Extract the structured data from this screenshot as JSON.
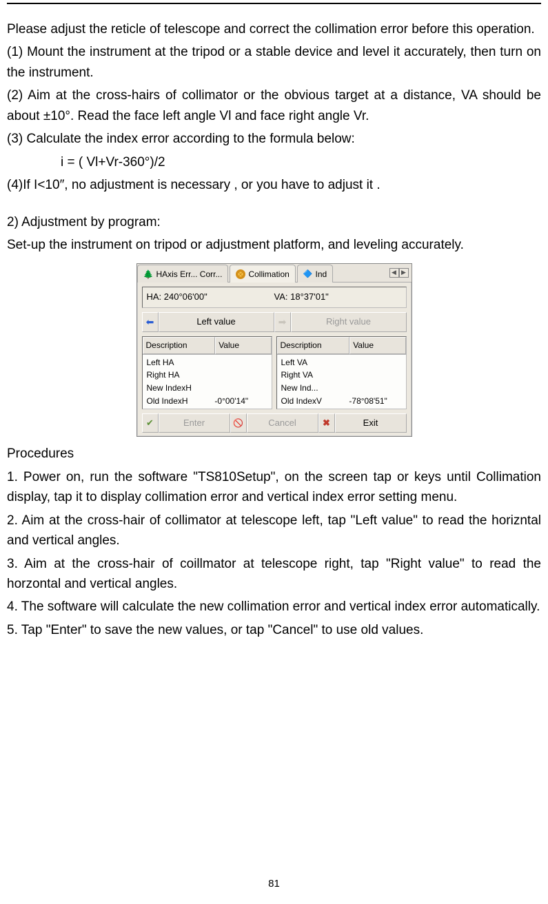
{
  "page_number": "81",
  "doc": {
    "intro": "Please adjust the reticle of telescope and correct the collimation error before this operation.",
    "step1": "(1) Mount the instrument at the tripod or a stable device and level it accurately, then turn on the instrument.",
    "step2": "(2) Aim at the cross-hairs of collimator or the obvious target at a distance, VA should be about ±10°. Read the face left angle Vl and face right angle Vr.",
    "step3": "(3) Calculate the index error according to the formula below:",
    "formula": "i = ( Vl+Vr-360°)/2",
    "step4": "(4)If I<10″, no adjustment is necessary , or you have to adjust it .",
    "adj_title": "2) Adjustment by program:",
    "adj_body": "Set-up the instrument on tripod or adjustment platform, and leveling accurately.",
    "proc_title": "Procedures",
    "proc1": "1. Power on, run the software \"TS810Setup\", on the screen tap     or     keys until Collimation display, tap it to display collimation error and vertical index error setting menu.",
    "proc2": "2. Aim at the cross-hair of collimator at telescope left, tap \"Left value\" to read the horizntal and vertical angles.",
    "proc3": "3. Aim at the cross-hair of coillmator at telescope right, tap \"Right value\" to read the horzontal and vertical angles.",
    "proc4": "4. The software will calculate the new collimation error and vertical index error automatically.",
    "proc5": "5. Tap \"Enter\" to save the new values, or tap \"Cancel\" to use old values."
  },
  "ui": {
    "tabs": {
      "haxis": "HAxis Err... Corr...",
      "collimation": "Collimation",
      "ind": "Ind"
    },
    "readout": {
      "ha_label": "HA:",
      "ha_value": "240°06'00\"",
      "va_label": "VA:",
      "va_value": "18°37'01\""
    },
    "buttons": {
      "left": "Left value",
      "right": "Right value",
      "enter": "Enter",
      "cancel": "Cancel",
      "exit": "Exit"
    },
    "headers": {
      "desc": "Description",
      "value": "Value"
    },
    "left_list": [
      {
        "desc": "Left HA",
        "val": ""
      },
      {
        "desc": "Right HA",
        "val": ""
      },
      {
        "desc": "New IndexH",
        "val": ""
      },
      {
        "desc": "Old IndexH",
        "val": "-0°00'14\""
      }
    ],
    "right_list": [
      {
        "desc": "Left VA",
        "val": ""
      },
      {
        "desc": "Right VA",
        "val": ""
      },
      {
        "desc": "New Ind...",
        "val": ""
      },
      {
        "desc": "Old IndexV",
        "val": "-78°08'51\""
      }
    ]
  }
}
